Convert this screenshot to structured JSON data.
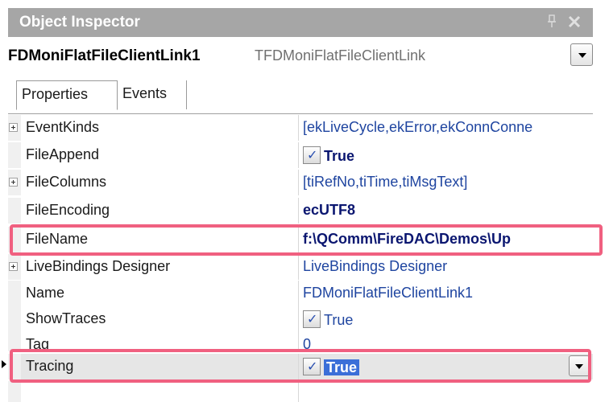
{
  "window": {
    "title": "Object Inspector",
    "pin_icon": "pin-icon",
    "close_icon": "close-icon"
  },
  "selector": {
    "component_name": "FDMoniFlatFileClientLink1",
    "component_type": "TFDMoniFlatFileClientLink"
  },
  "tabs": [
    {
      "label": "Properties",
      "active": true
    },
    {
      "label": "Events",
      "active": false
    }
  ],
  "properties": [
    {
      "name": "EventKinds",
      "value": "[ekLiveCycle,ekError,ekConnConne",
      "expandable": true
    },
    {
      "name": "FileAppend",
      "value": "True",
      "checkbox": true,
      "bold": true
    },
    {
      "name": "FileColumns",
      "value": "[tiRefNo,tiTime,tiMsgText]",
      "expandable": true
    },
    {
      "name": "FileEncoding",
      "value": "ecUTF8",
      "bold": true
    },
    {
      "name": "FileName",
      "value": "f:\\QComm\\FireDAC\\Demos\\Up",
      "bold": true,
      "highlighted": true
    },
    {
      "name": "LiveBindings Designer",
      "value": "LiveBindings Designer",
      "expandable": true
    },
    {
      "name": "Name",
      "value": "FDMoniFlatFileClientLink1"
    },
    {
      "name": "ShowTraces",
      "value": "True",
      "checkbox": true
    },
    {
      "name": "Tag",
      "value": "0"
    },
    {
      "name": "Tracing",
      "value": "True",
      "checkbox": true,
      "bold": true,
      "selected": true,
      "highlighted": true
    }
  ],
  "colors": {
    "highlight": "#f06080",
    "selection": "#3b6fd8",
    "value_text": "#1f45a0"
  }
}
